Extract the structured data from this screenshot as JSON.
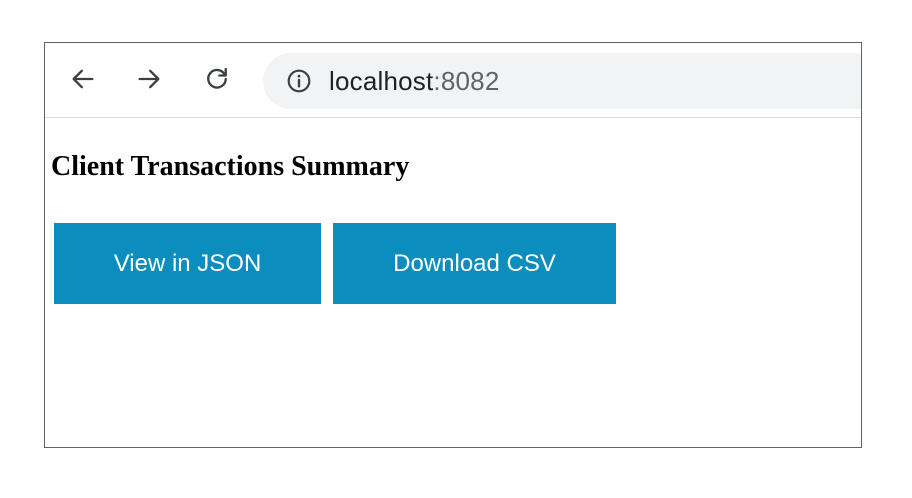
{
  "browser": {
    "url_host": "localhost",
    "url_port": ":8082",
    "icons": {
      "back": "arrow-left-icon",
      "forward": "arrow-right-icon",
      "reload": "reload-icon",
      "info": "info-circle-icon"
    },
    "colors": {
      "omnibox_bg": "#f1f3f4",
      "icon": "#5f6368"
    }
  },
  "page": {
    "title": "Client Transactions Summary",
    "buttons": {
      "view_json": "View in JSON",
      "download_csv": "Download CSV"
    },
    "colors": {
      "button_bg": "#0b8dbd",
      "button_text": "#ffffff"
    }
  }
}
